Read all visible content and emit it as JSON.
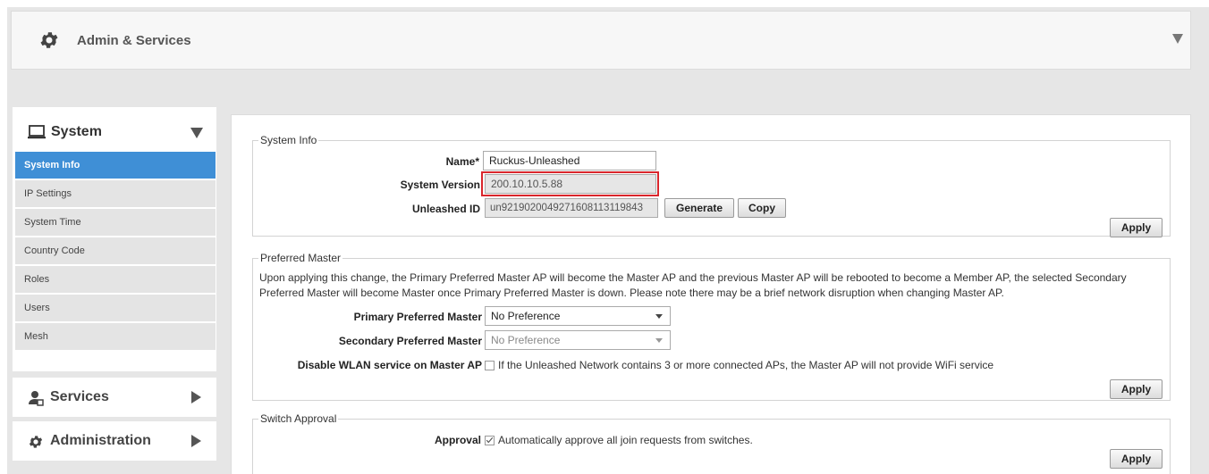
{
  "header": {
    "title": "Admin & Services"
  },
  "sidebar": {
    "system": {
      "label": "System",
      "items": [
        {
          "label": "System Info",
          "active": true
        },
        {
          "label": "IP Settings"
        },
        {
          "label": "System Time"
        },
        {
          "label": "Country Code"
        },
        {
          "label": "Roles"
        },
        {
          "label": "Users"
        },
        {
          "label": "Mesh"
        }
      ]
    },
    "services": {
      "label": "Services"
    },
    "administration": {
      "label": "Administration"
    }
  },
  "system_info": {
    "legend": "System Info",
    "name_label": "Name*",
    "name_value": "Ruckus-Unleashed",
    "version_label": "System Version",
    "version_value": "200.10.10.5.88",
    "id_label": "Unleashed ID",
    "id_value": "un92190200492716081131198​43",
    "generate_label": "Generate",
    "copy_label": "Copy",
    "apply_label": "Apply"
  },
  "preferred_master": {
    "legend": "Preferred Master",
    "description_line1": "Upon applying this change, the Primary Preferred Master AP will become the Master AP and the previous Master AP will be rebooted to become a Member AP, the selected Secondary",
    "description_line2": "Preferred Master will become Master once Primary Preferred Master is down. Please note there may be a brief network disruption when changing Master AP.",
    "primary_label": "Primary Preferred Master",
    "primary_value": "No Preference",
    "secondary_label": "Secondary Preferred Master",
    "secondary_value": "No Preference",
    "disable_label": "Disable WLAN service on Master AP",
    "disable_text": "If the Unleashed Network contains 3 or more connected APs, the Master AP will not provide WiFi service",
    "apply_label": "Apply"
  },
  "switch_approval": {
    "legend": "Switch Approval",
    "approval_label": "Approval",
    "approval_text": "Automatically approve all join requests from switches.",
    "apply_label": "Apply"
  },
  "colors": {
    "accent": "#3f8fd6",
    "highlight": "#d9262c"
  }
}
